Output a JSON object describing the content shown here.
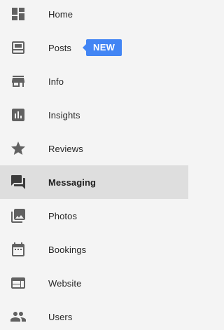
{
  "colors": {
    "background": "#f4f4f4",
    "active_background": "#dedede",
    "icon": "#616161",
    "badge": "#4285f4",
    "badge_text": "#ffffff"
  },
  "nav": {
    "items": [
      {
        "label": "Home",
        "icon": "dashboard-icon"
      },
      {
        "label": "Posts",
        "icon": "posts-icon",
        "badge": "NEW"
      },
      {
        "label": "Info",
        "icon": "storefront-icon"
      },
      {
        "label": "Insights",
        "icon": "insights-chart-icon"
      },
      {
        "label": "Reviews",
        "icon": "star-icon"
      },
      {
        "label": "Messaging",
        "icon": "chat-bubbles-icon",
        "active": true
      },
      {
        "label": "Photos",
        "icon": "photo-library-icon"
      },
      {
        "label": "Bookings",
        "icon": "calendar-icon"
      },
      {
        "label": "Website",
        "icon": "web-icon"
      },
      {
        "label": "Users",
        "icon": "people-icon"
      }
    ]
  }
}
